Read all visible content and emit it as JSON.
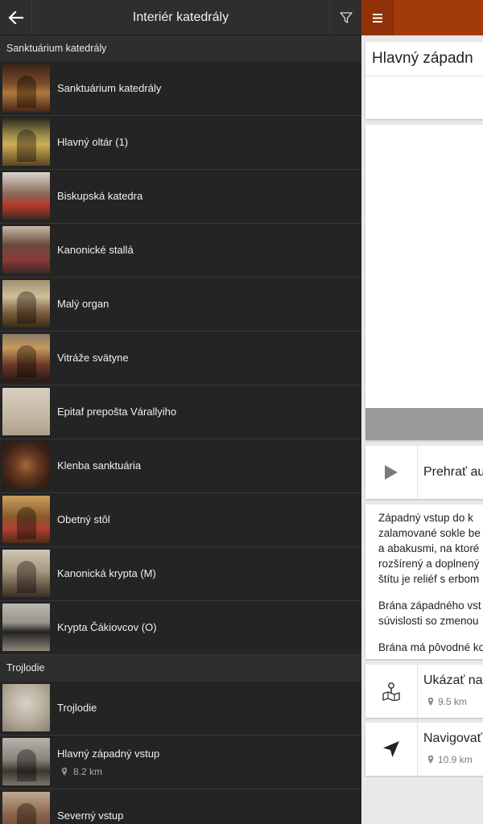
{
  "drawer": {
    "title": "Interiér katedrály",
    "sections": [
      {
        "header": "Sanktuárium katedrály",
        "items": [
          {
            "label": "Sanktuárium katedrály"
          },
          {
            "label": "Hlavný oltár (1)"
          },
          {
            "label": "Biskupská katedra"
          },
          {
            "label": "Kanonické stallá"
          },
          {
            "label": "Malý organ"
          },
          {
            "label": "Vitráže svätyne"
          },
          {
            "label": "Epitaf prepošta Várallyiho"
          },
          {
            "label": "Klenba sanktuária"
          },
          {
            "label": "Obetný stôl"
          },
          {
            "label": "Kanonická krypta (M)"
          },
          {
            "label": "Krypta Čákiovcov (O)"
          }
        ]
      },
      {
        "header": "Trojlodie",
        "items": [
          {
            "label": "Trojlodie"
          },
          {
            "label": "Hlavný západný vstup",
            "distance": "8.2 km"
          },
          {
            "label": "Severný vstup"
          }
        ]
      }
    ]
  },
  "detail": {
    "title": "Hlavný západn",
    "audio_label": "Prehrať au",
    "text_lines_1": [
      "Západný vstup do k",
      "zalamované sokle be",
      "a abakusmi, na ktoré",
      "rozšírený a doplnený",
      "štítu je reliéf s erbom"
    ],
    "text_lines_2": [
      "Brána západného vst",
      "súvislosti so zmenou"
    ],
    "text_line_3": "Brána má pôvodné ko",
    "map_label": "Ukázať na",
    "map_distance": "9.5 km",
    "nav_label": "Navigovať",
    "nav_distance": "10.9 km"
  },
  "colors": {
    "drawer_bg": "#242424",
    "header_bg": "#2e2e2e",
    "accent": "#a33a0a",
    "content_bg": "#e9e9e9"
  }
}
